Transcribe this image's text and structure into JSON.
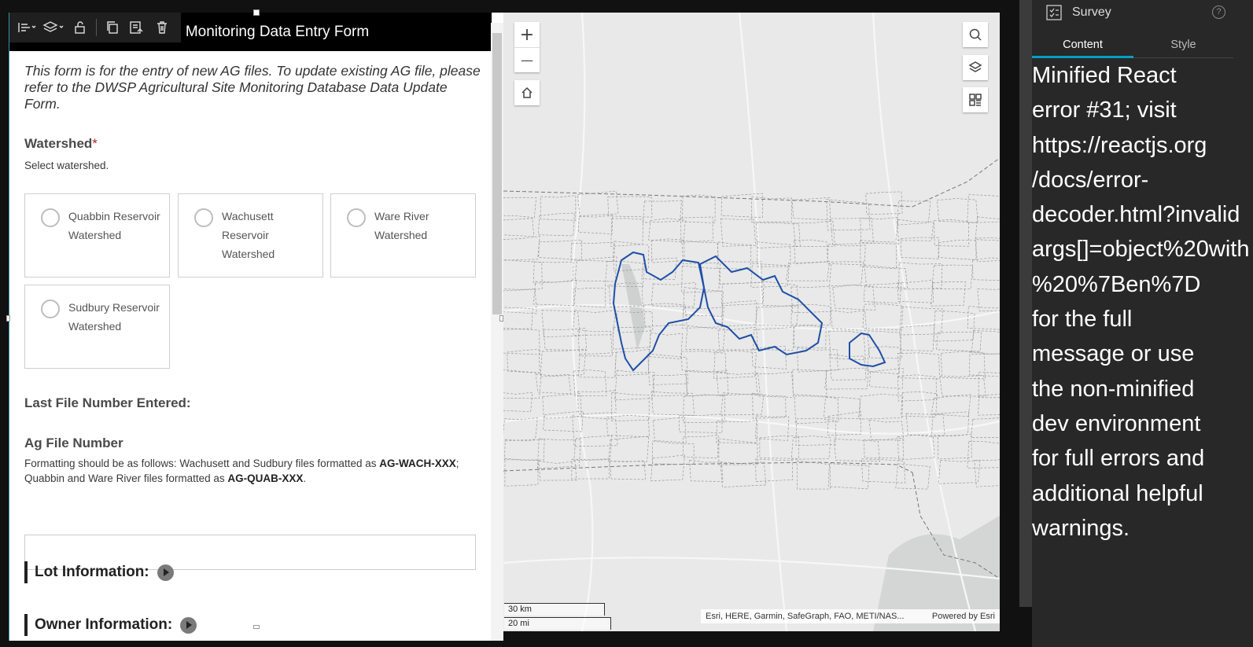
{
  "form": {
    "title": "DWSP Agricultural Site Monitoring Data Entry Form",
    "title_visible": "e Monitoring Data Entry Form",
    "intro": "This form is for the entry of new AG files. To update existing AG file, please refer to the DWSP Agricultural Site Monitoring Database Data Update Form.",
    "watershed": {
      "label": "Watershed",
      "required_mark": "*",
      "hint": "Select watershed.",
      "options": [
        {
          "label": "Quabbin Reservoir Watershed"
        },
        {
          "label": "Wachusett Reservoir Watershed"
        },
        {
          "label": "Ware River Watershed"
        },
        {
          "label": "Sudbury Reservoir Watershed"
        }
      ]
    },
    "last_file": {
      "label": "Last File Number Entered:"
    },
    "ag_file": {
      "label": "Ag File Number",
      "hint_1": "Formatting should be as follows: Wachusett and Sudbury files formatted as ",
      "hint_code_1": "AG-WACH-XXX",
      "hint_2": "; Quabbin and Ware River files formatted as ",
      "hint_code_2": "AG-QUAB-XXX",
      "hint_3": ".",
      "value": ""
    },
    "sections": [
      {
        "label": "Lot Information:"
      },
      {
        "label": "Owner Information:"
      }
    ]
  },
  "toolbar": {
    "icons": [
      "align-icon",
      "layers-arrange-icon",
      "unlock-icon",
      "duplicate-icon",
      "save-template-icon",
      "delete-icon"
    ]
  },
  "map": {
    "zoom_in": "+",
    "zoom_out": "—",
    "scale_km": "30 km",
    "scale_mi": "20 mi",
    "attribution": "Esri, HERE, Garmin, SafeGraph, FAO, METI/NAS...",
    "powered_by": "Powered by Esri",
    "watershed_outline_color": "#1f4fa8"
  },
  "panel": {
    "title": "Survey",
    "help": "?",
    "tabs": [
      {
        "label": "Content"
      },
      {
        "label": "Style"
      }
    ],
    "accent_color": "#00a0c6",
    "error_lines": [
      "Minified React",
      "error #31; visit",
      "https://reactjs.org",
      "/docs/error-",
      "decoder.html?invalid",
      "args[]=object%20with",
      "%20%7Ben%7D",
      "for the full",
      "message or use",
      "the non-minified",
      "dev environment",
      "for full errors and",
      "additional helpful",
      "warnings."
    ]
  }
}
